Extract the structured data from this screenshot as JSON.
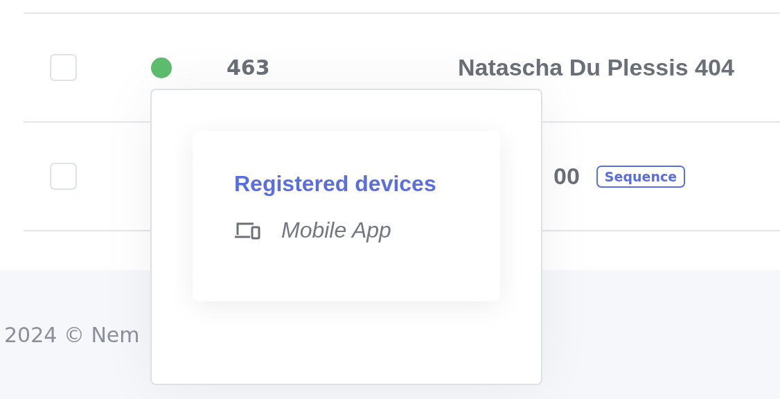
{
  "table": {
    "rows": [
      {
        "checked": false,
        "color": "#5ebd6e",
        "number": "463",
        "name": "Natascha Du Plessis 404"
      },
      {
        "checked": false,
        "name": "00",
        "badge": "Sequence"
      }
    ]
  },
  "popover": {
    "title": "Registered devices",
    "devices": [
      {
        "label": "Mobile App"
      }
    ]
  },
  "footer": {
    "copyright": "2024 © Nem"
  }
}
